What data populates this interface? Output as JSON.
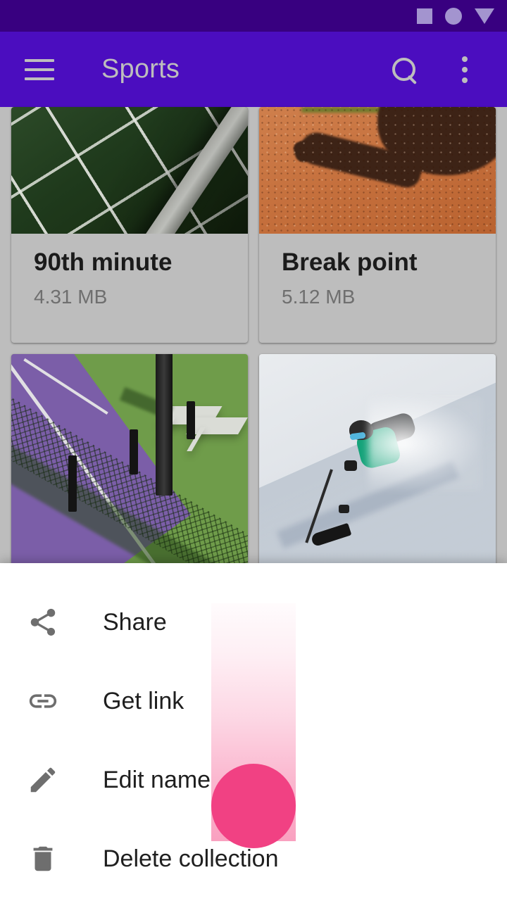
{
  "status_bar": {
    "background": "#380080",
    "icon_color": "#a394cf",
    "icons": [
      {
        "name": "square-indicator-icon",
        "glyph": "square"
      },
      {
        "name": "circle-indicator-icon",
        "glyph": "circle"
      },
      {
        "name": "triangle-indicator-icon",
        "glyph": "triangle-down"
      }
    ]
  },
  "app_bar": {
    "background": "#4b0dbf",
    "foreground": "#bdbdbd",
    "title": "Sports",
    "navigation_icon": "hamburger-menu-icon",
    "actions": [
      {
        "name": "search-icon",
        "label": "Search"
      },
      {
        "name": "overflow-menu-icon",
        "label": "More options"
      }
    ]
  },
  "grid": {
    "background": "#bdbdbd",
    "card_background": "#bdbdbd",
    "cards": [
      {
        "title": "90th minute",
        "size": "4.31 MB",
        "image": "soccer-goal-net",
        "has_caption": true
      },
      {
        "title": "Break point",
        "size": "5.12 MB",
        "image": "tennis-player-shadow-clay-court",
        "has_caption": true
      },
      {
        "title": "",
        "size": "",
        "image": "aerial-tennis-court-fence",
        "has_caption": false
      },
      {
        "title": "",
        "size": "",
        "image": "skier-powder-snow",
        "has_caption": false
      }
    ]
  },
  "bottom_sheet": {
    "background": "#ffffff",
    "icon_color": "#6e6e6e",
    "items": [
      {
        "label": "Share",
        "icon": "share-icon"
      },
      {
        "label": "Get link",
        "icon": "link-icon"
      },
      {
        "label": "Edit name",
        "icon": "pencil-edit-icon"
      },
      {
        "label": "Delete collection",
        "icon": "trash-delete-icon"
      }
    ]
  },
  "fab": {
    "name": "floating-action-button",
    "color": "#f14183",
    "trail_color": "#f44a86",
    "state": "morphing"
  }
}
